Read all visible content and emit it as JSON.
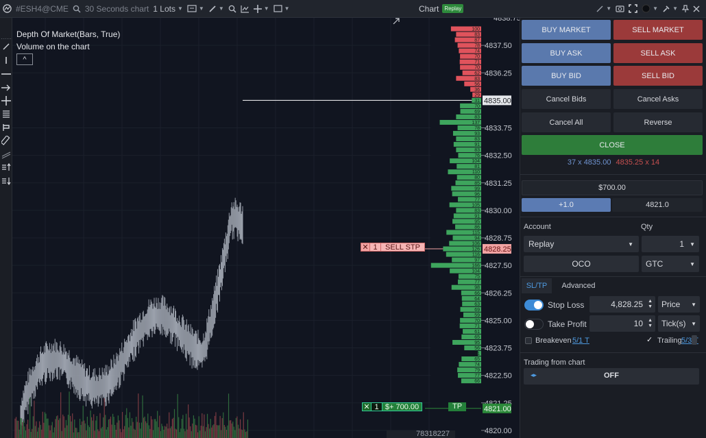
{
  "topbar": {
    "symbol": "#ESH4@CME",
    "timeframe": "30 Seconds chart",
    "lots": "1 Lots",
    "chart_label": "Chart",
    "replay_badge": "Replay"
  },
  "chart": {
    "overlay_line1": "Depth Of Market(Bars, True)",
    "overlay_line2": "Volume on the chart",
    "collapse_glyph": "^",
    "price_ticks": [
      {
        "p": 4837.5,
        "label": "4837.50"
      },
      {
        "p": 4836.25,
        "label": "4836.25"
      },
      {
        "p": 4833.75,
        "label": "4833.75"
      },
      {
        "p": 4832.5,
        "label": "4832.50"
      },
      {
        "p": 4831.25,
        "label": "4831.25"
      },
      {
        "p": 4830.0,
        "label": "4830.00"
      },
      {
        "p": 4828.75,
        "label": "4828.75"
      },
      {
        "p": 4827.5,
        "label": "4827.50"
      },
      {
        "p": 4826.25,
        "label": "4826.25"
      },
      {
        "p": 4825.0,
        "label": "4825.00"
      },
      {
        "p": 4823.75,
        "label": "4823.75"
      },
      {
        "p": 4822.5,
        "label": "4822.50"
      },
      {
        "p": 4821.25,
        "label": "4821.25"
      },
      {
        "p": 4820.0,
        "label": "4820.00"
      }
    ],
    "top_partial_label": "4838.75",
    "last_price": {
      "p": 4835.0,
      "label": "4835.00"
    },
    "stop_price": {
      "p": 4828.25,
      "label": "4828.25"
    },
    "tp_price": {
      "p": 4821.0,
      "label": "4821.00"
    },
    "stop_order": {
      "close": "✕",
      "qty": "1",
      "text": "SELL STP"
    },
    "tp_order": {
      "close": "✕",
      "qty": "1",
      "pnl": "$+ 700.00",
      "tag": "TP"
    },
    "volume_readout": "78318227",
    "colors": {
      "ask": "#e0535c",
      "bid": "#3ea55d",
      "price_line": "#ffffff",
      "stop": "#f2a3a3",
      "tp": "#2c8a3a"
    },
    "dom_asks": [
      "100",
      "83",
      "87",
      "78",
      "74",
      "70",
      "71",
      "70",
      "62",
      "83",
      "56",
      "36",
      "29"
    ],
    "dom_bids": [
      "31",
      "70",
      "69",
      "83",
      "137",
      "78",
      "93",
      "83",
      "91",
      "83",
      "76",
      "104",
      "81",
      "110",
      "80",
      "85",
      "99",
      "96",
      "77",
      "105",
      "83",
      "91",
      "95",
      "86",
      "115",
      "94",
      "106",
      "126",
      "116",
      "97",
      "166",
      "104",
      "75",
      "77",
      "98",
      "66",
      "64",
      "63",
      "69",
      "59",
      "70",
      "71",
      "61",
      "65",
      "95",
      "56",
      "11",
      "65",
      "74",
      "79",
      "77",
      "66"
    ]
  },
  "panel": {
    "buy_market": "BUY MARKET",
    "sell_market": "SELL MARKET",
    "buy_ask": "BUY ASK",
    "sell_ask": "SELL ASK",
    "buy_bid": "BUY BID",
    "sell_bid": "SELL BID",
    "cancel_bids": "Cancel Bids",
    "cancel_asks": "Cancel Asks",
    "cancel_all": "Cancel All",
    "reverse": "Reverse",
    "close": "CLOSE",
    "bid_info": "37 x 4835.00",
    "ask_info": "4835.25 x 14",
    "pnl": "$700.00",
    "position_qty": "+1.0",
    "position_price": "4821.0",
    "account_label": "Account",
    "qty_label": "Qty",
    "account_value": "Replay",
    "qty_value": "1",
    "oco": "OCO",
    "tif": "GTC",
    "tab_sltp": "SL/TP",
    "tab_advanced": "Advanced",
    "stop_loss_label": "Stop Loss",
    "stop_loss_value": "4,828.25",
    "stop_loss_type": "Price",
    "take_profit_label": "Take Profit",
    "take_profit_value": "10",
    "take_profit_type": "Tick(s)",
    "breakeven_label": "Breakeven",
    "breakeven_link": "5/1 T",
    "trailing_label": "Trailing",
    "trailing_link": "5/3 T",
    "trading_from_chart": "Trading from chart",
    "tfc_state": "OFF",
    "accent": "#3d8bd6"
  }
}
